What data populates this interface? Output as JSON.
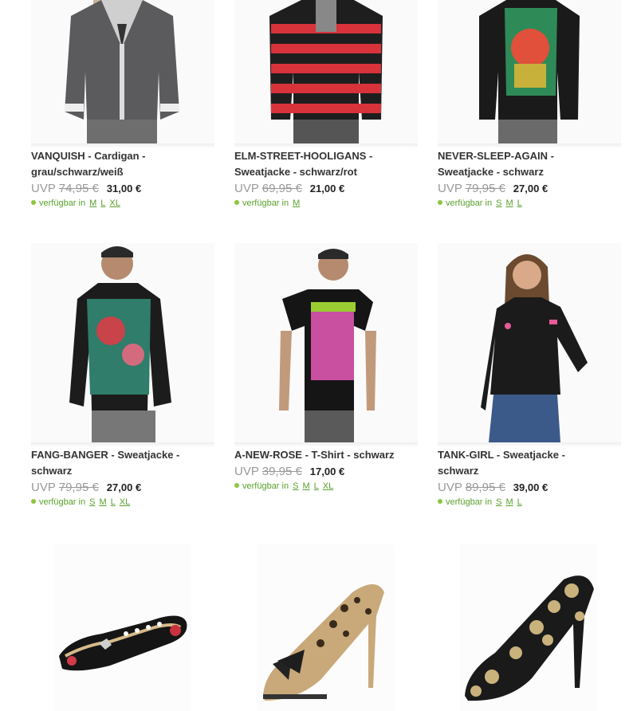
{
  "products": [
    {
      "name": "VANQUISH",
      "rest_line1": " - Cardigan -",
      "line2": "grau/schwarz/weiß",
      "uvp": "UVP",
      "old_price": "74,95 €",
      "price": "31,00 €",
      "avail": "verfügbar in",
      "sizes": [
        "M",
        "L",
        "XL"
      ]
    },
    {
      "name": "ELM-STREET-HOOLIGANS",
      "rest_line1": " -",
      "line2": "Sweatjacke - schwarz/rot",
      "uvp": "UVP",
      "old_price": "69,95 €",
      "price": "21,00 €",
      "avail": "verfügbar in",
      "sizes": [
        "M"
      ]
    },
    {
      "name": "NEVER-SLEEP-AGAIN",
      "rest_line1": " -",
      "line2": "Sweatjacke - schwarz",
      "uvp": "UVP",
      "old_price": "79,95 €",
      "price": "27,00 €",
      "avail": "verfügbar in",
      "sizes": [
        "S",
        "M",
        "L"
      ]
    },
    {
      "name": "FANG-BANGER",
      "rest_line1": " - Sweatjacke -",
      "line2": "schwarz",
      "uvp": "UVP",
      "old_price": "79,95 €",
      "price": "27,00 €",
      "avail": "verfügbar in",
      "sizes": [
        "S",
        "M",
        "L",
        "XL"
      ]
    },
    {
      "name": "A-NEW-ROSE",
      "rest_line1": " - T-Shirt - schwarz",
      "line2": "",
      "uvp": "UVP",
      "old_price": "39,95 €",
      "price": "17,00 €",
      "avail": "verfügbar in",
      "sizes": [
        "S",
        "M",
        "L",
        "XL"
      ]
    },
    {
      "name": "TANK-GIRL",
      "rest_line1": " - Sweatjacke -",
      "line2": "schwarz",
      "uvp": "UVP",
      "old_price": "89,95 €",
      "price": "39,00 €",
      "avail": "verfügbar in",
      "sizes": [
        "S",
        "M",
        "L"
      ]
    }
  ],
  "shoes": [
    {
      "kind": "ballerina-flat"
    },
    {
      "kind": "leopard-peep-toe-pump"
    },
    {
      "kind": "skull-pump"
    }
  ],
  "colors": {
    "available": "#5aa02c",
    "dot": "#8cc63f"
  }
}
